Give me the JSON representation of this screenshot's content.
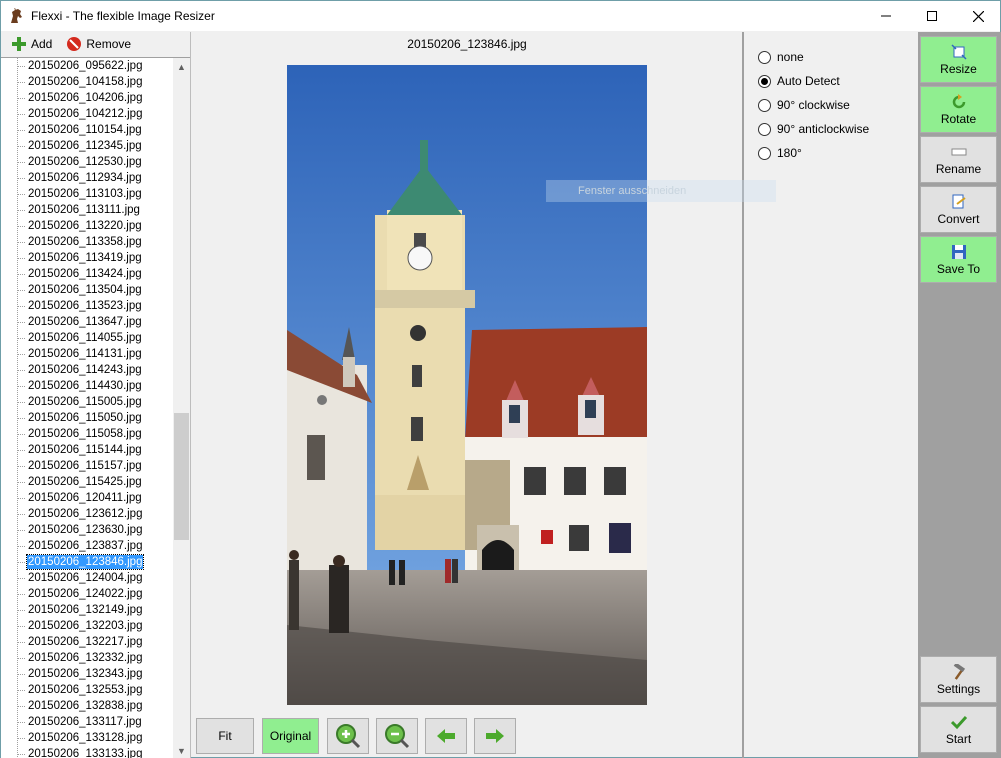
{
  "window": {
    "title": "Flexxi - The flexible Image Resizer"
  },
  "toolbar": {
    "add_label": "Add",
    "remove_label": "Remove"
  },
  "files": [
    "20150206_095622.jpg",
    "20150206_104158.jpg",
    "20150206_104206.jpg",
    "20150206_104212.jpg",
    "20150206_110154.jpg",
    "20150206_112345.jpg",
    "20150206_112530.jpg",
    "20150206_112934.jpg",
    "20150206_113103.jpg",
    "20150206_113111.jpg",
    "20150206_113220.jpg",
    "20150206_113358.jpg",
    "20150206_113419.jpg",
    "20150206_113424.jpg",
    "20150206_113504.jpg",
    "20150206_113523.jpg",
    "20150206_113647.jpg",
    "20150206_114055.jpg",
    "20150206_114131.jpg",
    "20150206_114243.jpg",
    "20150206_114430.jpg",
    "20150206_115005.jpg",
    "20150206_115050.jpg",
    "20150206_115058.jpg",
    "20150206_115144.jpg",
    "20150206_115157.jpg",
    "20150206_115425.jpg",
    "20150206_120411.jpg",
    "20150206_123612.jpg",
    "20150206_123630.jpg",
    "20150206_123837.jpg",
    "20150206_123846.jpg",
    "20150206_124004.jpg",
    "20150206_124022.jpg",
    "20150206_132149.jpg",
    "20150206_132203.jpg",
    "20150206_132217.jpg",
    "20150206_132332.jpg",
    "20150206_132343.jpg",
    "20150206_132553.jpg",
    "20150206_132838.jpg",
    "20150206_133117.jpg",
    "20150206_133128.jpg",
    "20150206_133133.jpg"
  ],
  "selected_file": "20150206_123846.jpg",
  "preview": {
    "filename": "20150206_123846.jpg"
  },
  "view_buttons": {
    "fit": "Fit",
    "original": "Original"
  },
  "rotation": {
    "options": [
      "none",
      "Auto Detect",
      "90° clockwise",
      "90° anticlockwise",
      "180°"
    ],
    "selected": "Auto Detect",
    "ghost_tooltip": "Fenster ausschneiden"
  },
  "actions": {
    "resize": "Resize",
    "rotate": "Rotate",
    "rename": "Rename",
    "convert": "Convert",
    "save_to": "Save To",
    "settings": "Settings",
    "start": "Start"
  },
  "colors": {
    "active_green": "#90ee90",
    "selection_blue": "#3399ff"
  }
}
